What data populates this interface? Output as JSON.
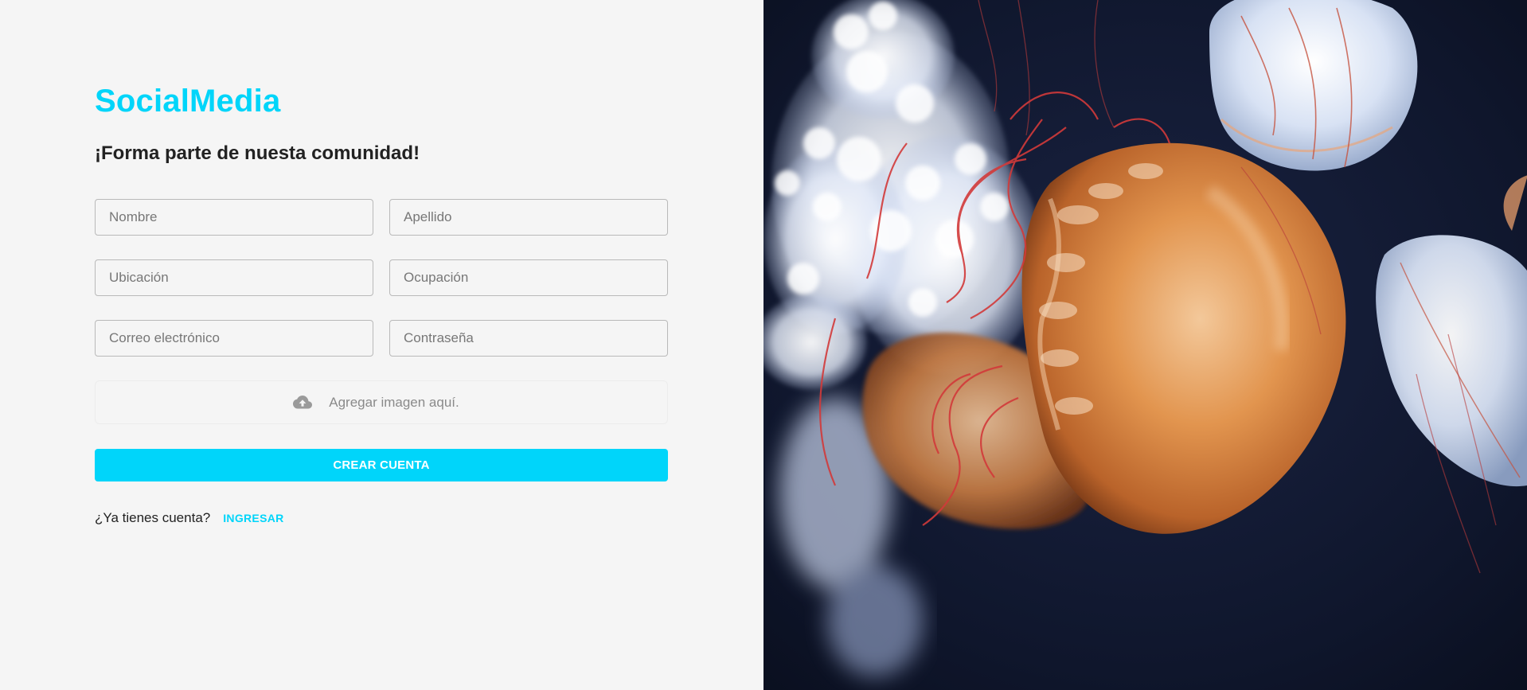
{
  "brand": {
    "name": "SocialMedia"
  },
  "form": {
    "heading": "¡Forma parte de nuesta comunidad!",
    "fields": {
      "first_name": {
        "placeholder": "Nombre",
        "value": ""
      },
      "last_name": {
        "placeholder": "Apellido",
        "value": ""
      },
      "location": {
        "placeholder": "Ubicación",
        "value": ""
      },
      "occupation": {
        "placeholder": "Ocupación",
        "value": ""
      },
      "email": {
        "placeholder": "Correo electrónico",
        "value": ""
      },
      "password": {
        "placeholder": "Contraseña",
        "value": ""
      }
    },
    "dropzone": {
      "label": "Agregar imagen aquí.",
      "icon": "cloud-upload-icon"
    },
    "submit_label": "CREAR CUENTA",
    "login_prompt": "¿Ya tienes cuenta?",
    "login_link": "INGRESAR"
  },
  "hero_image": {
    "subject": "jellyfish-photo"
  },
  "colors": {
    "accent": "#00d5fa",
    "background": "#f5f5f5",
    "text": "#222222",
    "photo_background": "#0e1427"
  }
}
